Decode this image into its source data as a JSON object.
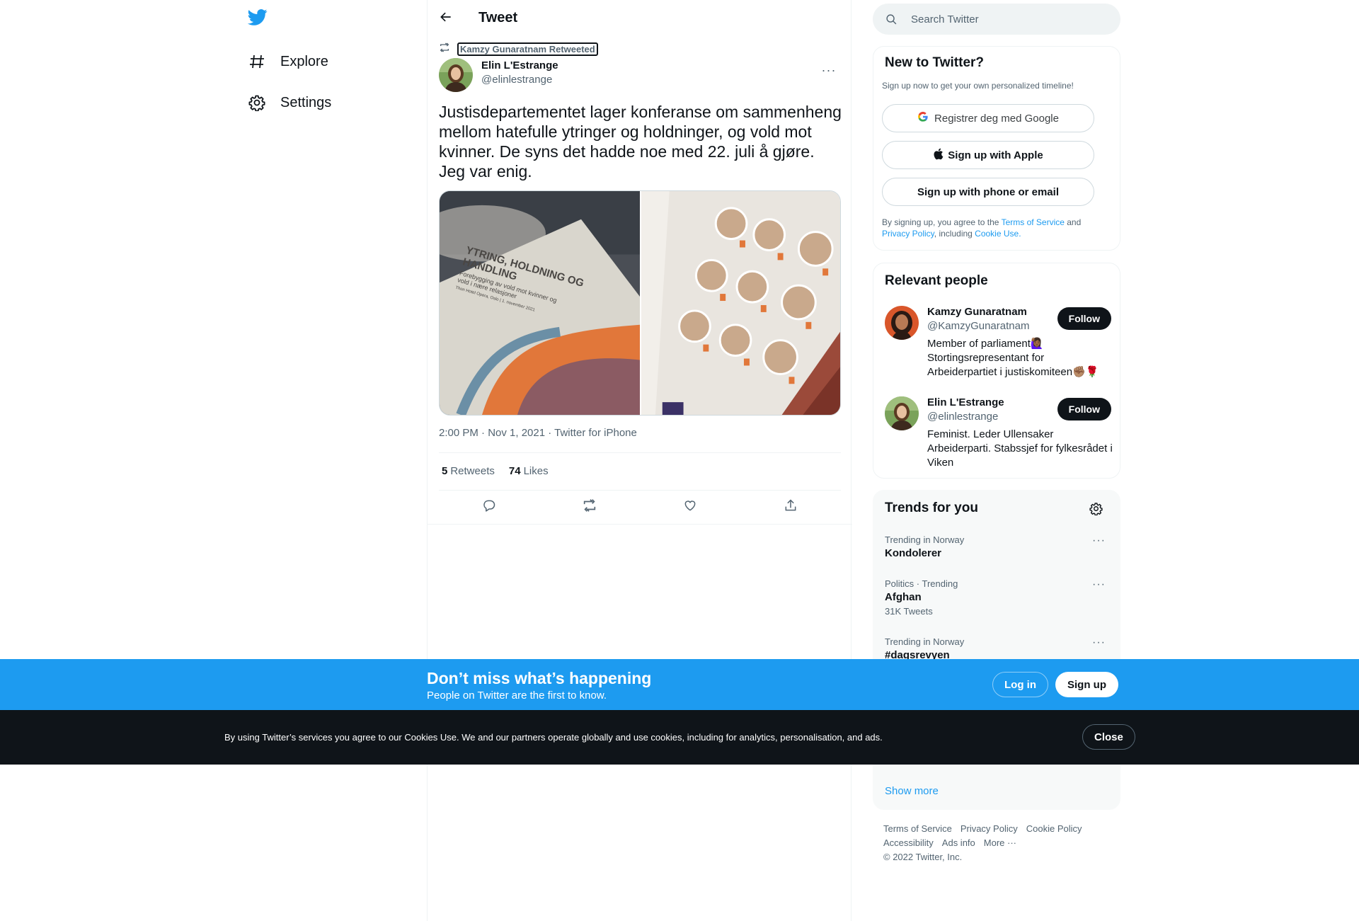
{
  "nav": {
    "items": [
      {
        "label": "Explore",
        "icon": "hashtag-icon"
      },
      {
        "label": "Settings",
        "icon": "gear-icon"
      }
    ]
  },
  "header": {
    "title": "Tweet"
  },
  "tweet": {
    "retweeted_by": "Kamzy Gunaratnam Retweeted",
    "author_name": "Elin L'Estrange",
    "author_handle": "@elinlestrange",
    "text": "Justisdepartementet lager konferanse om sammenheng mellom hatefulle ytringer og holdninger, og vold mot kvinner. De syns det hadde noe med 22. juli å gjøre. Jeg var enig.",
    "media": {
      "left_image_text": [
        "YTRING, HOLDNING OG",
        "HANDLING",
        "Forebygging av vold mot kvinner og",
        "vold i nære relasjoner",
        "Thon Hotel Opera, Oslo | 1. november 2021"
      ]
    },
    "meta": "2:00 PM · Nov 1, 2021 · Twitter for iPhone",
    "retweets_count": "5",
    "retweets_label": "Retweets",
    "likes_count": "74",
    "likes_label": "Likes"
  },
  "search": {
    "placeholder": "Search Twitter"
  },
  "signup_card": {
    "title": "New to Twitter?",
    "subtitle": "Sign up now to get your own personalized timeline!",
    "google_label": "Registrer deg med Google",
    "apple_label": "Sign up with Apple",
    "phone_label": "Sign up with phone or email",
    "legal_prefix": "By signing up, you agree to the ",
    "terms": "Terms of Service",
    "and": " and",
    "privacy": "Privacy Policy",
    "including": ", including ",
    "cookie": "Cookie Use."
  },
  "relevant": {
    "title": "Relevant people",
    "people": [
      {
        "name": "Kamzy Gunaratnam",
        "handle": "@KamzyGunaratnam",
        "bio": "Member of parliament🙋🏾‍♀️ Stortingsrepresentant for Arbeiderpartiet i justiskomiteen✊🏽🌹",
        "follow": "Follow"
      },
      {
        "name": "Elin L'Estrange",
        "handle": "@elinlestrange",
        "bio": "Feminist. Leder Ullensaker Arbeiderparti. Stabssjef for fylkesrådet i Viken",
        "follow": "Follow"
      }
    ]
  },
  "trends": {
    "title": "Trends for you",
    "items": [
      {
        "context": "Trending in Norway",
        "title": "Kondolerer",
        "count": ""
      },
      {
        "context": "Politics · Trending",
        "title": "Afghan",
        "count": "31K Tweets"
      },
      {
        "context": "Trending in Norway",
        "title": "#dagsrevyen",
        "count": ""
      }
    ],
    "show_more": "Show more"
  },
  "footer": {
    "links": [
      "Terms of Service",
      "Privacy Policy",
      "Cookie Policy",
      "Accessibility",
      "Ads info",
      "More ···"
    ],
    "copyright": "© 2022 Twitter, Inc."
  },
  "signup_bar": {
    "headline": "Don’t miss what’s happening",
    "sub": "People on Twitter are the first to know.",
    "login": "Log in",
    "signup": "Sign up"
  },
  "cookie_bar": {
    "text": "By using Twitter’s services you agree to our Cookies Use. We and our partners operate globally and use cookies, including for analytics, personalisation, and ads.",
    "close": "Close"
  },
  "colors": {
    "brand_blue": "#1d9bf0",
    "text_primary": "#0f1419",
    "text_secondary": "#536471",
    "cookie_bg": "#0f1419"
  }
}
